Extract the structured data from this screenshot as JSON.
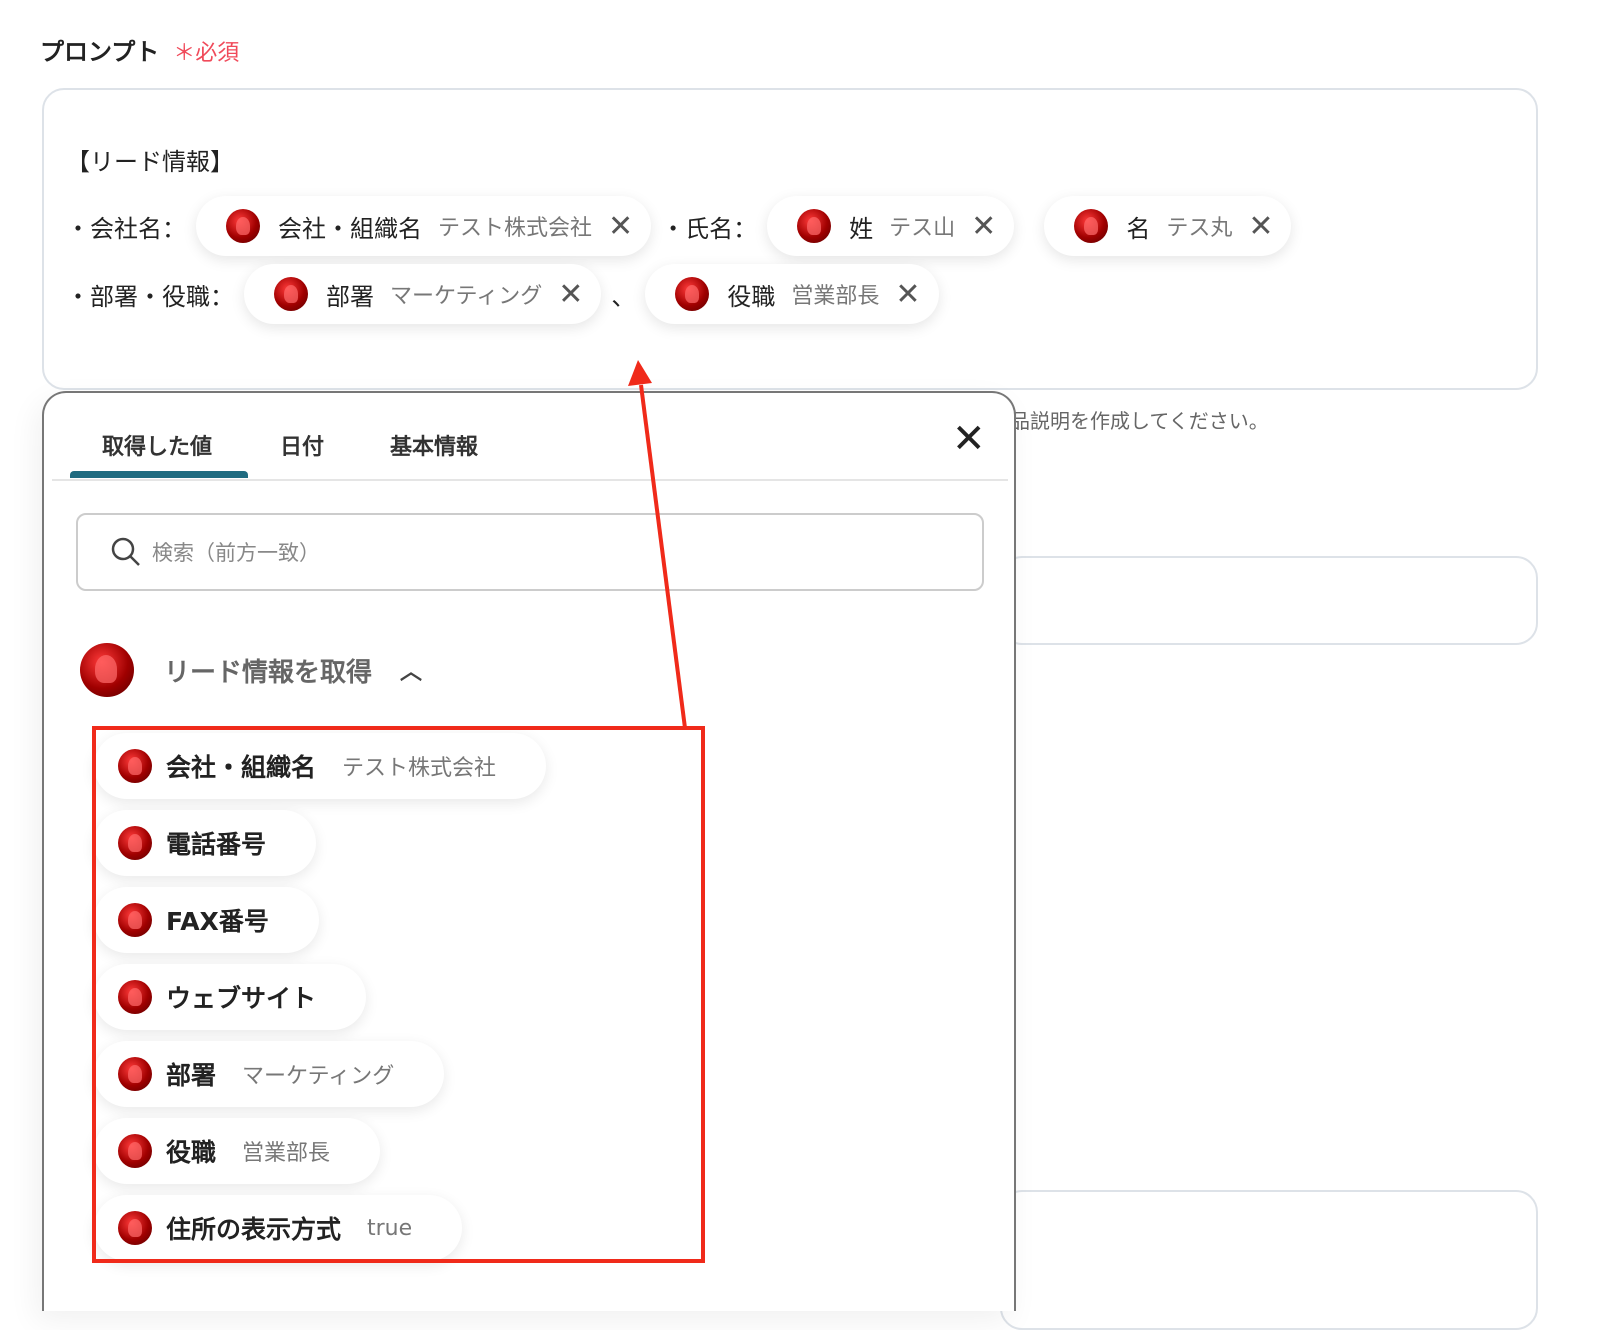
{
  "field": {
    "label": "プロンプト",
    "required": "＊必須"
  },
  "prompt": {
    "heading": "【リード情報】",
    "line1_prefix": "・会社名：",
    "line1_mid": "・氏名：",
    "line2_prefix": "・部署・役職：",
    "line2_sep": "、",
    "chips": [
      {
        "name": "会社・組織名",
        "value": "テスト株式会社"
      },
      {
        "name": "姓",
        "value": "テス山"
      },
      {
        "name": "名",
        "value": "テス丸"
      },
      {
        "name": "部署",
        "value": "マーケティング"
      },
      {
        "name": "役職",
        "value": "営業部長"
      }
    ],
    "remove_glyph": "✕"
  },
  "hint": "品説明を作成してください。",
  "popup": {
    "tabs": [
      {
        "label": "取得した値"
      },
      {
        "label": "日付"
      },
      {
        "label": "基本情報"
      }
    ],
    "close_glyph": "✕",
    "search_placeholder": "検索（前方一致）",
    "group": {
      "title": "リード情報を取得",
      "chevron": "︿"
    },
    "items": [
      {
        "name": "会社・組織名",
        "value": "テスト株式会社"
      },
      {
        "name": "電話番号",
        "value": ""
      },
      {
        "name": "FAX番号",
        "value": ""
      },
      {
        "name": "ウェブサイト",
        "value": ""
      },
      {
        "name": "部署",
        "value": "マーケティング"
      },
      {
        "name": "役職",
        "value": "営業部長"
      },
      {
        "name": "住所の表示方式",
        "value": "true"
      }
    ]
  },
  "colors": {
    "accent": "#1f6b80",
    "annotation": "#f02a1a",
    "required": "#f04a5a"
  }
}
